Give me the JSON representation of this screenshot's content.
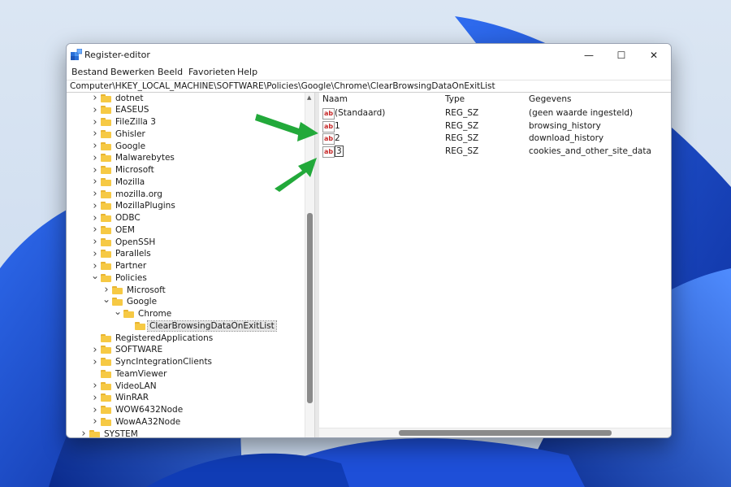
{
  "window": {
    "title": "Register-editor",
    "controls": {
      "minimize": "—",
      "maximize": "☐",
      "close": "✕"
    }
  },
  "menu": [
    "Bestand",
    "Bewerken",
    "Beeld",
    "Favorieten",
    "Help"
  ],
  "address": "Computer\\HKEY_LOCAL_MACHINE\\SOFTWARE\\Policies\\Google\\Chrome\\ClearBrowsingDataOnExitList",
  "tree": [
    {
      "label": "dotnet",
      "level": 1,
      "expanded": false
    },
    {
      "label": "EASEUS",
      "level": 1,
      "expanded": false
    },
    {
      "label": "FileZilla 3",
      "level": 1,
      "expanded": false
    },
    {
      "label": "Ghisler",
      "level": 1,
      "expanded": false
    },
    {
      "label": "Google",
      "level": 1,
      "expanded": false
    },
    {
      "label": "Malwarebytes",
      "level": 1,
      "expanded": false
    },
    {
      "label": "Microsoft",
      "level": 1,
      "expanded": false
    },
    {
      "label": "Mozilla",
      "level": 1,
      "expanded": false
    },
    {
      "label": "mozilla.org",
      "level": 1,
      "expanded": false
    },
    {
      "label": "MozillaPlugins",
      "level": 1,
      "expanded": false
    },
    {
      "label": "ODBC",
      "level": 1,
      "expanded": false
    },
    {
      "label": "OEM",
      "level": 1,
      "expanded": false
    },
    {
      "label": "OpenSSH",
      "level": 1,
      "expanded": false
    },
    {
      "label": "Parallels",
      "level": 1,
      "expanded": false
    },
    {
      "label": "Partner",
      "level": 1,
      "expanded": false
    },
    {
      "label": "Policies",
      "level": 1,
      "expanded": true
    },
    {
      "label": "Microsoft",
      "level": 2,
      "expanded": false
    },
    {
      "label": "Google",
      "level": 2,
      "expanded": true
    },
    {
      "label": "Chrome",
      "level": 3,
      "expanded": true
    },
    {
      "label": "ClearBrowsingDataOnExitList",
      "level": 4,
      "leaf": true,
      "selected": true
    },
    {
      "label": "RegisteredApplications",
      "level": 1,
      "leaf": true
    },
    {
      "label": "SOFTWARE",
      "level": 1,
      "expanded": false
    },
    {
      "label": "SyncIntegrationClients",
      "level": 1,
      "expanded": false
    },
    {
      "label": "TeamViewer",
      "level": 1,
      "leaf": true
    },
    {
      "label": "VideoLAN",
      "level": 1,
      "expanded": false
    },
    {
      "label": "WinRAR",
      "level": 1,
      "expanded": false
    },
    {
      "label": "WOW6432Node",
      "level": 1,
      "expanded": false
    },
    {
      "label": "WowAA32Node",
      "level": 1,
      "expanded": false
    },
    {
      "label": "SYSTEM",
      "level": 0,
      "expanded": false
    }
  ],
  "values": {
    "headers": {
      "name": "Naam",
      "type": "Type",
      "data": "Gegevens"
    },
    "icon_text": "ab",
    "rows": [
      {
        "name": "(Standaard)",
        "type": "REG_SZ",
        "data": "(geen waarde ingesteld)"
      },
      {
        "name": "1",
        "type": "REG_SZ",
        "data": "browsing_history"
      },
      {
        "name": "2",
        "type": "REG_SZ",
        "data": "download_history"
      },
      {
        "name": "3",
        "type": "REG_SZ",
        "data": "cookies_and_other_site_data",
        "editing": true
      }
    ]
  },
  "colors": {
    "arrow": "#22a93a",
    "folder": "#f6c944",
    "wallpaper": "#1a47d6"
  }
}
